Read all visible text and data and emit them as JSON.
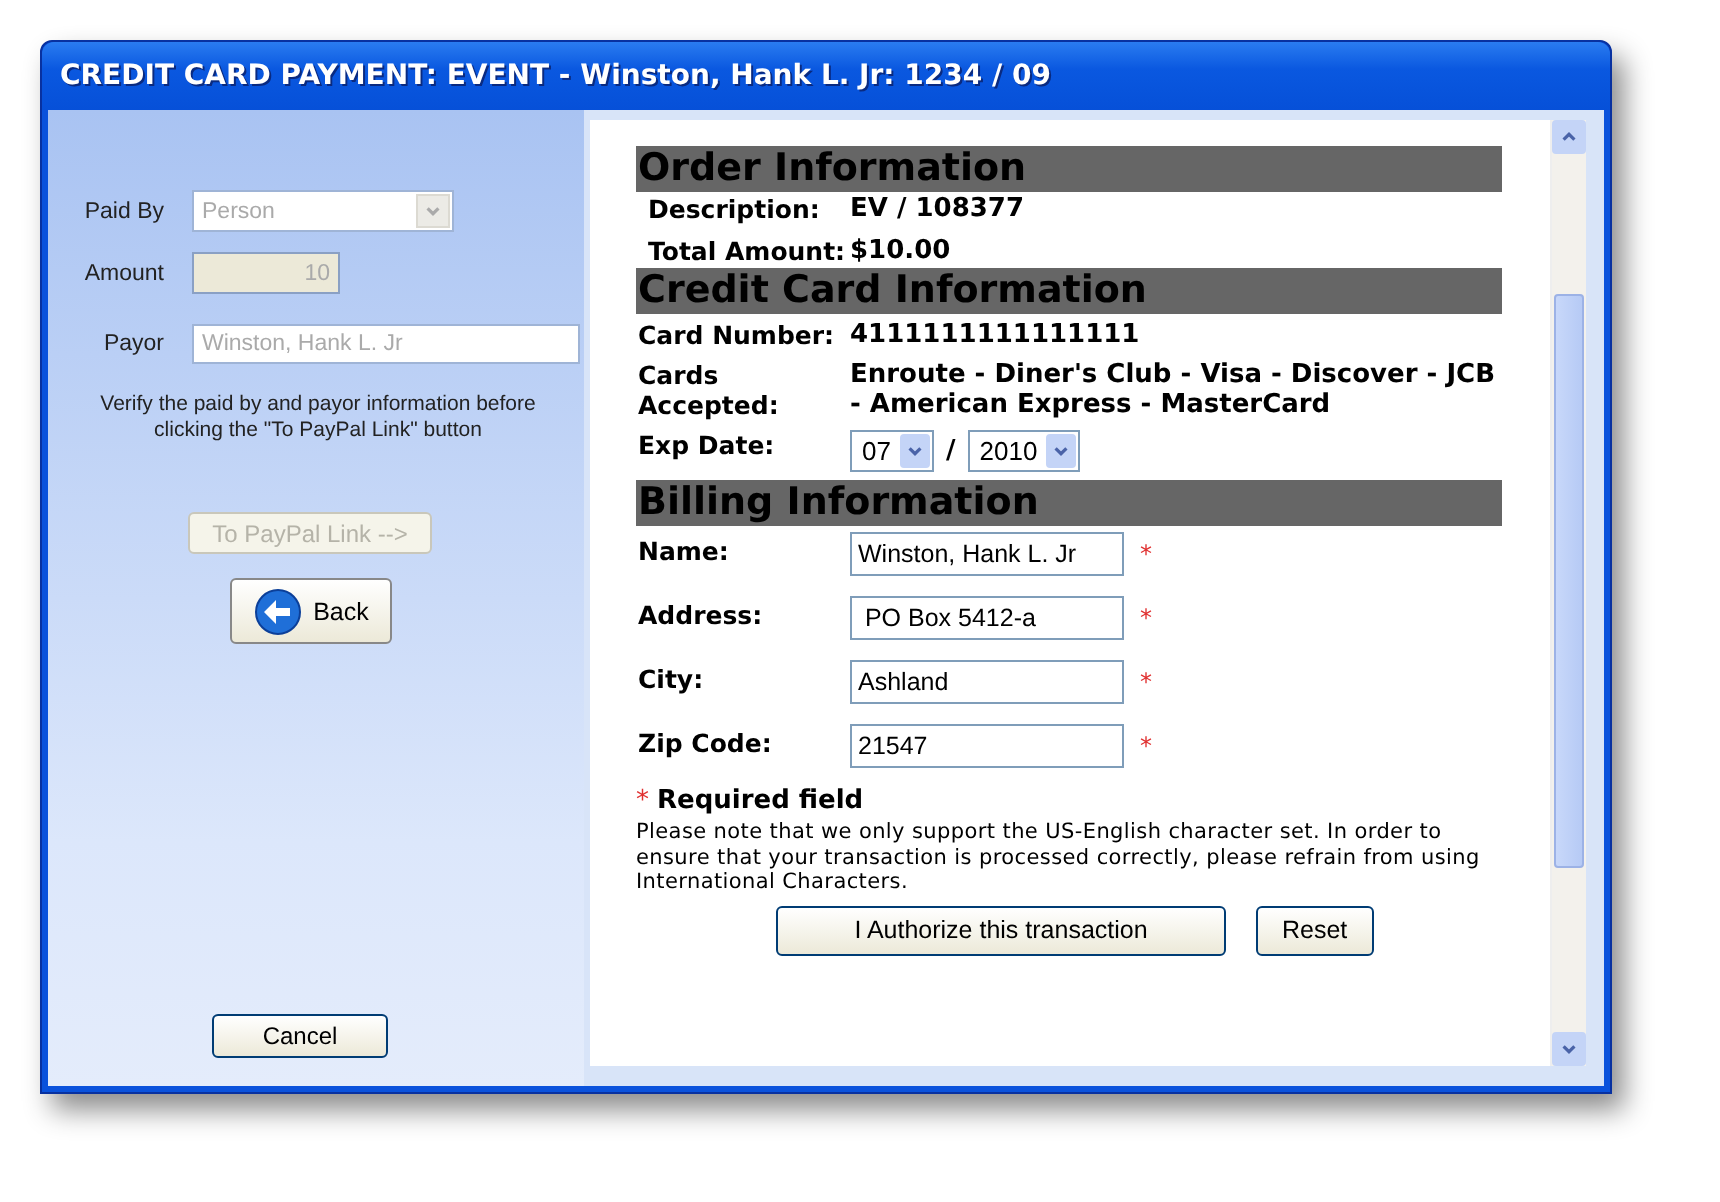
{
  "window": {
    "title": "CREDIT CARD PAYMENT: EVENT - Winston, Hank L. Jr: 1234 / 09"
  },
  "left_panel": {
    "fields": [
      {
        "kind": "select",
        "label": "Paid By",
        "value": "Person",
        "disabled": true
      },
      {
        "kind": "number",
        "label": "Amount",
        "value": "10",
        "disabled": true
      },
      {
        "kind": "text",
        "label": "Payor",
        "value": "Winston, Hank L. Jr",
        "disabled": true
      }
    ],
    "note": "Verify the paid by and payor information before clicking the \"To PayPal Link\" button",
    "paypal_button": {
      "label": "To PayPal Link -->",
      "disabled": true
    },
    "back_button": {
      "label": "Back"
    },
    "cancel_button": {
      "label": "Cancel"
    }
  },
  "form": {
    "sections": [
      {
        "title": "Order Information",
        "rows": [
          {
            "kind": "text",
            "label": "Description:",
            "value": "EV / 108377"
          },
          {
            "kind": "text",
            "label": "Total Amount:",
            "value": "$10.00"
          }
        ]
      },
      {
        "title": "Credit Card Information",
        "rows": [
          {
            "kind": "text",
            "label": "Card Number:",
            "value": "4111111111111111"
          },
          {
            "kind": "text",
            "label": "Cards Accepted:",
            "value": "Enroute - Diner's Club - Visa - Discover - JCB - American Express - MasterCard"
          },
          {
            "kind": "date",
            "label": "Exp Date:",
            "month": "07",
            "separator": "/",
            "year": "2010"
          }
        ]
      },
      {
        "title": "Billing Information",
        "rows": [
          {
            "kind": "input",
            "label": "Name:",
            "value": "Winston, Hank L. Jr",
            "required_mark": "*"
          },
          {
            "kind": "input",
            "label": "Address:",
            "value": " PO Box 5412-a",
            "required_mark": "*"
          },
          {
            "kind": "input",
            "label": "City:",
            "value": "Ashland",
            "required_mark": "*"
          },
          {
            "kind": "input",
            "label": "Zip Code:",
            "value": "21547",
            "required_mark": "*"
          }
        ]
      }
    ],
    "required_legend": {
      "mark": "*",
      "text": "Required field"
    },
    "notice": "Please note that we only support the US-English character set. In order to ensure that your transaction is processed correctly, please refrain from using International Characters.",
    "authorize_button": {
      "label": "I Authorize this transaction"
    },
    "reset_button": {
      "label": "Reset"
    }
  }
}
